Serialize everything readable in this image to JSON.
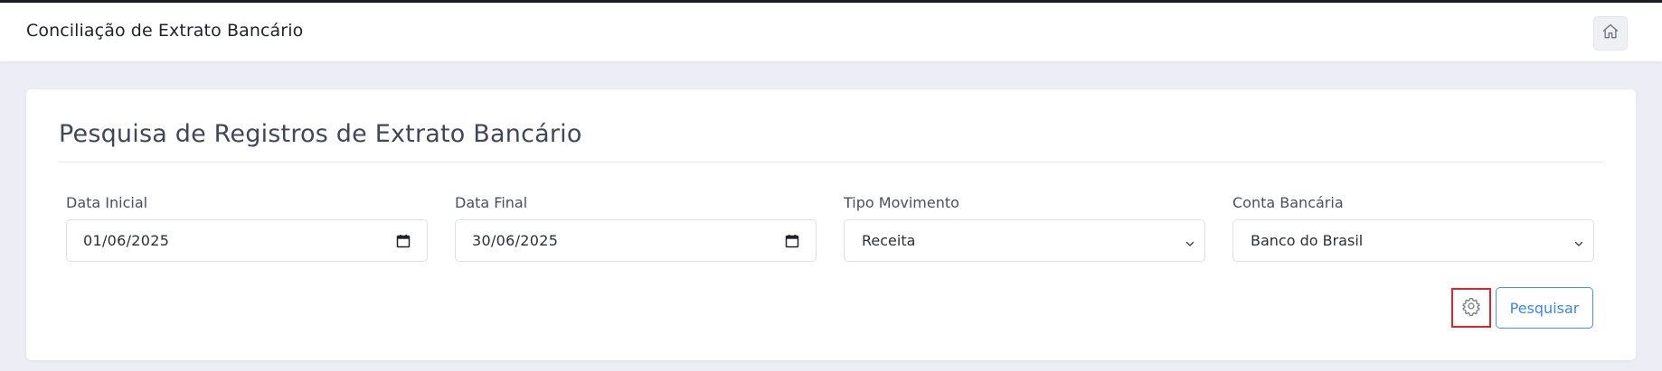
{
  "header": {
    "title": "Conciliação de Extrato Bancário",
    "home_icon": "home-icon"
  },
  "card": {
    "title": "Pesquisa de Registros de Extrato Bancário"
  },
  "filters": {
    "start_date": {
      "label": "Data Inicial",
      "value": "01/06/2025",
      "icon": "calendar-icon"
    },
    "end_date": {
      "label": "Data Final",
      "value": "30/06/2025",
      "icon": "calendar-icon"
    },
    "movement_type": {
      "label": "Tipo Movimento",
      "value": "Receita",
      "icon": "chevron-down-icon"
    },
    "bank_account": {
      "label": "Conta Bancária",
      "value": "Banco do Brasil",
      "icon": "chevron-down-icon"
    }
  },
  "actions": {
    "settings_icon": "gear-icon",
    "search_label": "Pesquisar"
  },
  "colors": {
    "page_background": "#ecedf5",
    "highlight_border": "#e8202a",
    "primary_accent": "#3d86e6"
  }
}
